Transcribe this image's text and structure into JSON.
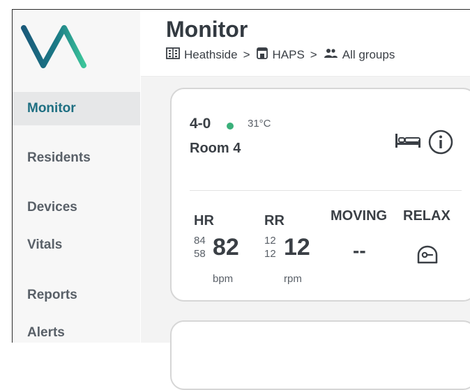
{
  "sidebar": {
    "items": [
      {
        "label": "Monitor",
        "active": true
      },
      {
        "label": "Residents"
      },
      {
        "label": "Devices"
      },
      {
        "label": "Vitals"
      },
      {
        "label": "Reports"
      },
      {
        "label": "Alerts"
      }
    ],
    "logo_colors": {
      "left": "#1a5a7a",
      "right": "#3cc49a"
    }
  },
  "header": {
    "title": "Monitor",
    "breadcrumb": [
      {
        "label": "Heathside",
        "icon": "building-icon"
      },
      {
        "label": "HAPS",
        "icon": "house-icon"
      },
      {
        "label": "All groups",
        "icon": "group-icon"
      }
    ],
    "separator": ">"
  },
  "card": {
    "unit_id": "4-0",
    "status_color": "#3ab07a",
    "temperature": "31°C",
    "room": "Room 4",
    "icons": [
      "bed-icon",
      "info-icon"
    ],
    "hr": {
      "label": "HR",
      "high": "84",
      "low": "58",
      "value": "82",
      "unit": "bpm"
    },
    "rr": {
      "label": "RR",
      "high": "12",
      "low": "12",
      "value": "12",
      "unit": "rpm"
    },
    "moving": {
      "label": "MOVING",
      "value": "--"
    },
    "relax": {
      "label": "RELAX",
      "icon": "relax-icon"
    }
  },
  "colors": {
    "accent": "#1e6f82",
    "status_ok": "#3ab07a"
  }
}
